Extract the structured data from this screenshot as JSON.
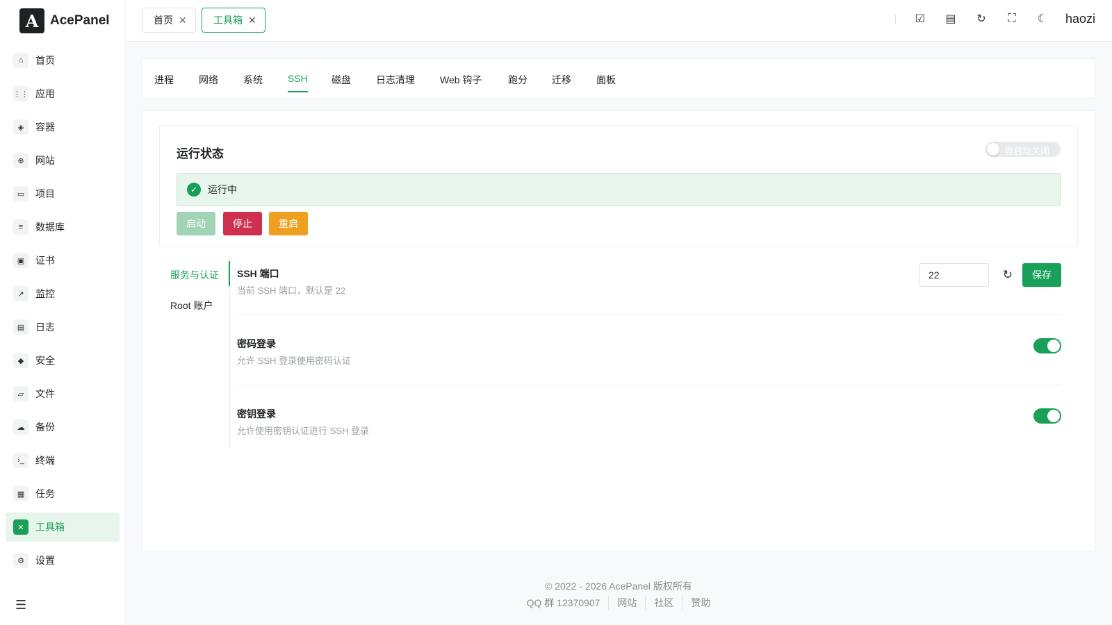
{
  "brand": {
    "logo_letter": "A",
    "name": "AcePanel"
  },
  "sidebar": {
    "items": [
      {
        "label": "首页",
        "icon": "⌂"
      },
      {
        "label": "应用",
        "icon": "⋮⋮"
      },
      {
        "label": "容器",
        "icon": "◈"
      },
      {
        "label": "网站",
        "icon": "⊕"
      },
      {
        "label": "项目",
        "icon": "▭"
      },
      {
        "label": "数据库",
        "icon": "≡"
      },
      {
        "label": "证书",
        "icon": "▣"
      },
      {
        "label": "监控",
        "icon": "↗"
      },
      {
        "label": "日志",
        "icon": "▤"
      },
      {
        "label": "安全",
        "icon": "◆"
      },
      {
        "label": "文件",
        "icon": "▱"
      },
      {
        "label": "备份",
        "icon": "☁"
      },
      {
        "label": "终端",
        "icon": "›_"
      },
      {
        "label": "任务",
        "icon": "▦"
      },
      {
        "label": "工具箱",
        "icon": "✕"
      },
      {
        "label": "设置",
        "icon": "⚙"
      }
    ],
    "collapse_icon": "☰"
  },
  "topbar": {
    "tabs": [
      {
        "label": "首页",
        "close": "✕"
      },
      {
        "label": "工具箱",
        "close": "✕"
      }
    ],
    "icons": {
      "tasks": "☑",
      "doc": "▤",
      "refresh": "↻",
      "fullscreen": "⛶",
      "theme": "☾"
    },
    "user": "haozi"
  },
  "toolbox": {
    "tabs": [
      "进程",
      "网络",
      "系统",
      "SSH",
      "磁盘",
      "日志清理",
      "Web 钩子",
      "跑分",
      "迁移",
      "面板"
    ],
    "active_tab": "SSH"
  },
  "status": {
    "title": "运行状态",
    "autostart_label": "自启动关闭",
    "running_text": "运行中",
    "check": "✓",
    "start": "启动",
    "stop": "停止",
    "restart": "重启"
  },
  "ssh": {
    "vtabs": [
      "服务与认证",
      "Root 账户"
    ],
    "port": {
      "title": "SSH 端口",
      "desc": "当前 SSH 端口，默认是 22",
      "value": "22",
      "reset_icon": "↻",
      "save": "保存"
    },
    "password": {
      "title": "密码登录",
      "desc": "允许 SSH 登录使用密码认证"
    },
    "key": {
      "title": "密钥登录",
      "desc": "允许使用密钥认证进行 SSH 登录"
    }
  },
  "footer": {
    "copyright": "© 2022 - 2026 AcePanel 版权所有",
    "links": [
      "QQ 群 12370907",
      "网站",
      "社区",
      "赞助"
    ]
  },
  "colors": {
    "primary": "#18a058",
    "danger": "#d03050",
    "warning": "#f0a020"
  }
}
